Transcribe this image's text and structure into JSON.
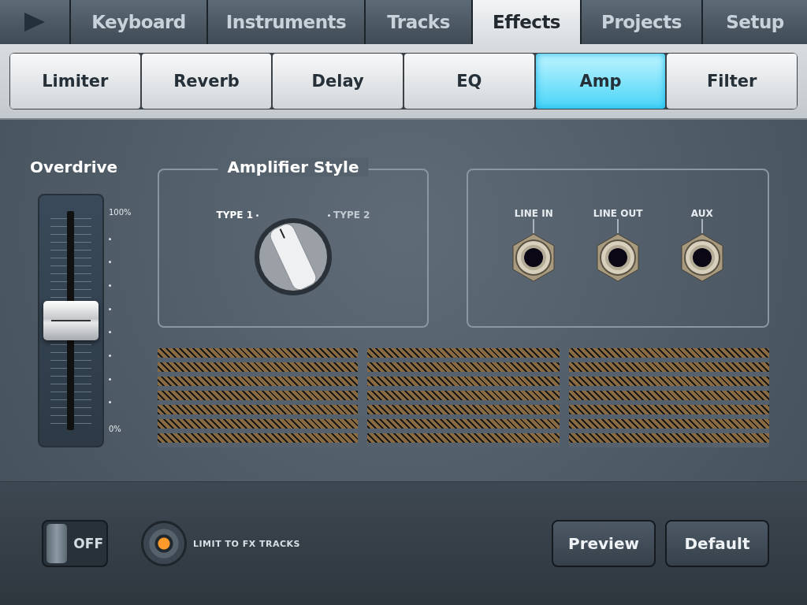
{
  "tabs": [
    {
      "kind": "play",
      "selected": false
    },
    {
      "label": "Keyboard",
      "selected": false
    },
    {
      "label": "Instruments",
      "selected": false
    },
    {
      "label": "Tracks",
      "selected": false
    },
    {
      "label": "Effects",
      "selected": true
    },
    {
      "label": "Projects",
      "selected": false
    },
    {
      "label": "Setup",
      "selected": false
    }
  ],
  "effect_tabs": [
    {
      "label": "Limiter",
      "selected": false
    },
    {
      "label": "Reverb",
      "selected": false
    },
    {
      "label": "Delay",
      "selected": false
    },
    {
      "label": "EQ",
      "selected": false
    },
    {
      "label": "Amp",
      "selected": true
    },
    {
      "label": "Filter",
      "selected": false
    }
  ],
  "overdrive": {
    "title": "Overdrive",
    "level": 0.5,
    "max_label": "100%",
    "min_label": "0%"
  },
  "amplifier_style": {
    "title": "Amplifier Style",
    "options": [
      {
        "label": "TYPE 1",
        "selected": true
      },
      {
        "label": "TYPE 2",
        "selected": false
      }
    ]
  },
  "jacks": [
    {
      "label": "LINE IN"
    },
    {
      "label": "LINE OUT"
    },
    {
      "label": "AUX"
    }
  ],
  "footer": {
    "toggle": {
      "label": "OFF",
      "on": false
    },
    "limit": {
      "label": "LIMIT TO FX TRACKS",
      "lit": true
    },
    "buttons": [
      "Preview",
      "Default"
    ]
  }
}
